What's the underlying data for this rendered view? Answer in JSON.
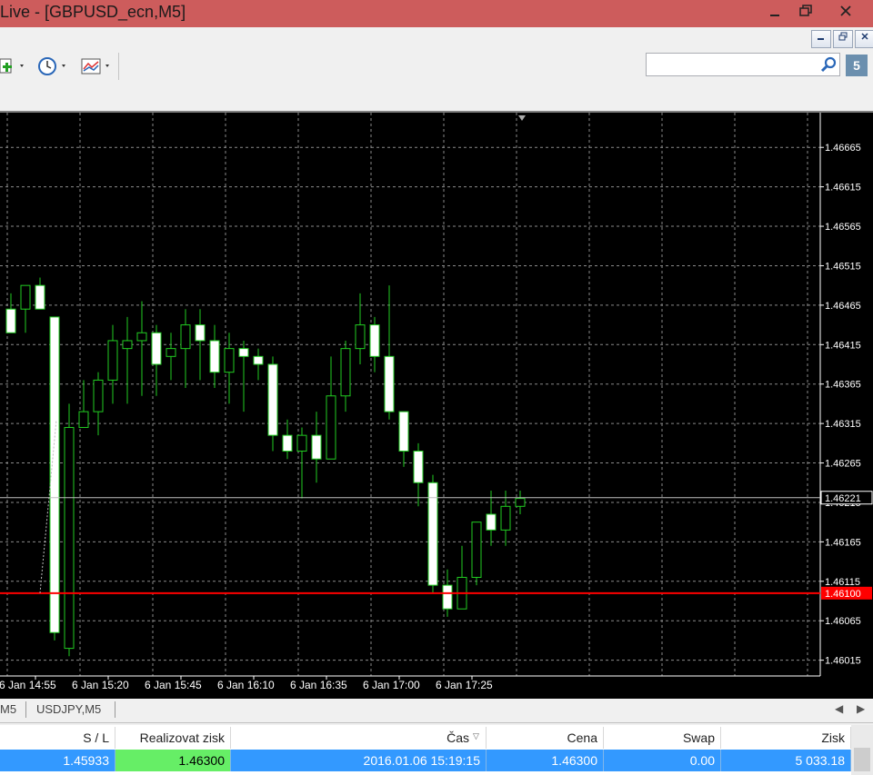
{
  "window": {
    "title": "Live - [GBPUSD_ecn,M5]"
  },
  "search": {
    "placeholder": ""
  },
  "community_badge": "5",
  "chart_data": {
    "type": "candlestick",
    "symbol": "GBPUSD_ecn",
    "timeframe": "M5",
    "y_ticks": [
      "1.46665",
      "1.46615",
      "1.46565",
      "1.46515",
      "1.46465",
      "1.46415",
      "1.46365",
      "1.46315",
      "1.46265",
      "1.46215",
      "1.46165",
      "1.46115",
      "1.46065",
      "1.46015"
    ],
    "x_ticks": [
      "6 Jan 14:55",
      "6 Jan 15:20",
      "6 Jan 15:45",
      "6 Jan 16:10",
      "6 Jan 16:35",
      "6 Jan 17:00",
      "6 Jan 17:25"
    ],
    "ylim": [
      1.45995,
      1.46709
    ],
    "grid": true,
    "bid_line": {
      "value": 1.46221,
      "label": "1.46221"
    },
    "order_line": {
      "value": 1.461,
      "label": "1.46100",
      "color": "#ff0000"
    },
    "candles": [
      {
        "o": 1.4646,
        "h": 1.4648,
        "l": 1.4643,
        "c": 1.4643
      },
      {
        "o": 1.4646,
        "h": 1.4649,
        "l": 1.4643,
        "c": 1.4649
      },
      {
        "o": 1.4649,
        "h": 1.465,
        "l": 1.4646,
        "c": 1.4646
      },
      {
        "o": 1.4645,
        "h": 1.4645,
        "l": 1.4604,
        "c": 1.4605
      },
      {
        "o": 1.4603,
        "h": 1.4634,
        "l": 1.4602,
        "c": 1.4631
      },
      {
        "o": 1.4631,
        "h": 1.4637,
        "l": 1.4631,
        "c": 1.4633
      },
      {
        "o": 1.4633,
        "h": 1.4638,
        "l": 1.463,
        "c": 1.4637
      },
      {
        "o": 1.4637,
        "h": 1.4644,
        "l": 1.4634,
        "c": 1.4642
      },
      {
        "o": 1.4641,
        "h": 1.4645,
        "l": 1.4634,
        "c": 1.4642
      },
      {
        "o": 1.4642,
        "h": 1.4647,
        "l": 1.4635,
        "c": 1.4643
      },
      {
        "o": 1.4643,
        "h": 1.4644,
        "l": 1.4635,
        "c": 1.4639
      },
      {
        "o": 1.464,
        "h": 1.4643,
        "l": 1.4637,
        "c": 1.4641
      },
      {
        "o": 1.4641,
        "h": 1.4646,
        "l": 1.4636,
        "c": 1.4644
      },
      {
        "o": 1.4644,
        "h": 1.4646,
        "l": 1.4637,
        "c": 1.4642
      },
      {
        "o": 1.4642,
        "h": 1.4644,
        "l": 1.4636,
        "c": 1.4638
      },
      {
        "o": 1.4638,
        "h": 1.4643,
        "l": 1.4634,
        "c": 1.4641
      },
      {
        "o": 1.4641,
        "h": 1.4642,
        "l": 1.4633,
        "c": 1.464
      },
      {
        "o": 1.464,
        "h": 1.4641,
        "l": 1.4637,
        "c": 1.4639
      },
      {
        "o": 1.4639,
        "h": 1.464,
        "l": 1.4628,
        "c": 1.463
      },
      {
        "o": 1.463,
        "h": 1.4632,
        "l": 1.4627,
        "c": 1.4628
      },
      {
        "o": 1.4628,
        "h": 1.4631,
        "l": 1.4622,
        "c": 1.463
      },
      {
        "o": 1.463,
        "h": 1.4633,
        "l": 1.4624,
        "c": 1.4627
      },
      {
        "o": 1.4627,
        "h": 1.464,
        "l": 1.4627,
        "c": 1.4635
      },
      {
        "o": 1.4635,
        "h": 1.4642,
        "l": 1.4633,
        "c": 1.4641
      },
      {
        "o": 1.4641,
        "h": 1.4648,
        "l": 1.4639,
        "c": 1.4644
      },
      {
        "o": 1.4644,
        "h": 1.4645,
        "l": 1.4638,
        "c": 1.464
      },
      {
        "o": 1.464,
        "h": 1.4649,
        "l": 1.4632,
        "c": 1.4633
      },
      {
        "o": 1.4633,
        "h": 1.4633,
        "l": 1.4626,
        "c": 1.4628
      },
      {
        "o": 1.4628,
        "h": 1.4629,
        "l": 1.4621,
        "c": 1.4624
      },
      {
        "o": 1.4624,
        "h": 1.4625,
        "l": 1.461,
        "c": 1.4611
      },
      {
        "o": 1.4611,
        "h": 1.4613,
        "l": 1.4607,
        "c": 1.4608
      },
      {
        "o": 1.4608,
        "h": 1.4616,
        "l": 1.4608,
        "c": 1.4612
      },
      {
        "o": 1.4612,
        "h": 1.4619,
        "l": 1.4611,
        "c": 1.4619
      },
      {
        "o": 1.462,
        "h": 1.4623,
        "l": 1.4616,
        "c": 1.4618
      },
      {
        "o": 1.4618,
        "h": 1.4623,
        "l": 1.4616,
        "c": 1.4621
      },
      {
        "o": 1.4621,
        "h": 1.4623,
        "l": 1.462,
        "c": 1.4622
      }
    ]
  },
  "tabs": [
    {
      "label": "M5"
    },
    {
      "label": "USDJPY,M5"
    }
  ],
  "terminal": {
    "columns": [
      "S / L",
      "Realizovat zisk",
      "Čas",
      "Cena",
      "Swap",
      "Zisk"
    ],
    "sort_arrow": "▽",
    "row": {
      "sl": "1.45933",
      "tp": "1.46300",
      "time": "2016.01.06 15:19:15",
      "price": "1.46300",
      "swap": "0.00",
      "profit": "5 033.18"
    },
    "highlight_color": "#66ee66",
    "selected_color": "#3399ff"
  }
}
